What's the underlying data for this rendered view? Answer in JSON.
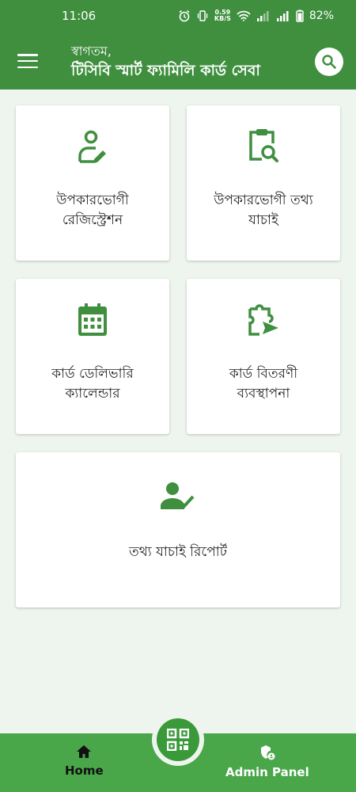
{
  "status_bar": {
    "time": "11:06",
    "net_speed_value": "0.59",
    "net_speed_unit": "KB/S",
    "battery": "82%"
  },
  "header": {
    "greeting": "স্বাগতম,",
    "title": "টিসিবি স্মার্ট ফ্যামিলি কার্ড সেবা"
  },
  "cards": [
    {
      "line1": "উপকারভোগী",
      "line2": "রেজিস্ট্রেশন",
      "icon": "user-register-icon"
    },
    {
      "line1": "উপকারভোগী তথ্য",
      "line2": "যাচাই",
      "icon": "clipboard-search-icon"
    },
    {
      "line1": "কার্ড ডেলিভারি",
      "line2": "ক্যালেন্ডার",
      "icon": "calendar-icon"
    },
    {
      "line1": "কার্ড বিতরণী",
      "line2": "ব্যবস্থাপনা",
      "icon": "puzzle-send-icon"
    },
    {
      "line1": "তথ্য যাচাই রিপোর্ট",
      "icon": "user-check-icon"
    }
  ],
  "bottom_nav": {
    "home": "Home",
    "admin": "Admin Panel",
    "fab_icon": "qr-code-icon"
  },
  "colors": {
    "primary": "#3f8f3f",
    "nav": "#49a649",
    "icon_green": "#3f8f3f",
    "background": "#eef5ee"
  }
}
